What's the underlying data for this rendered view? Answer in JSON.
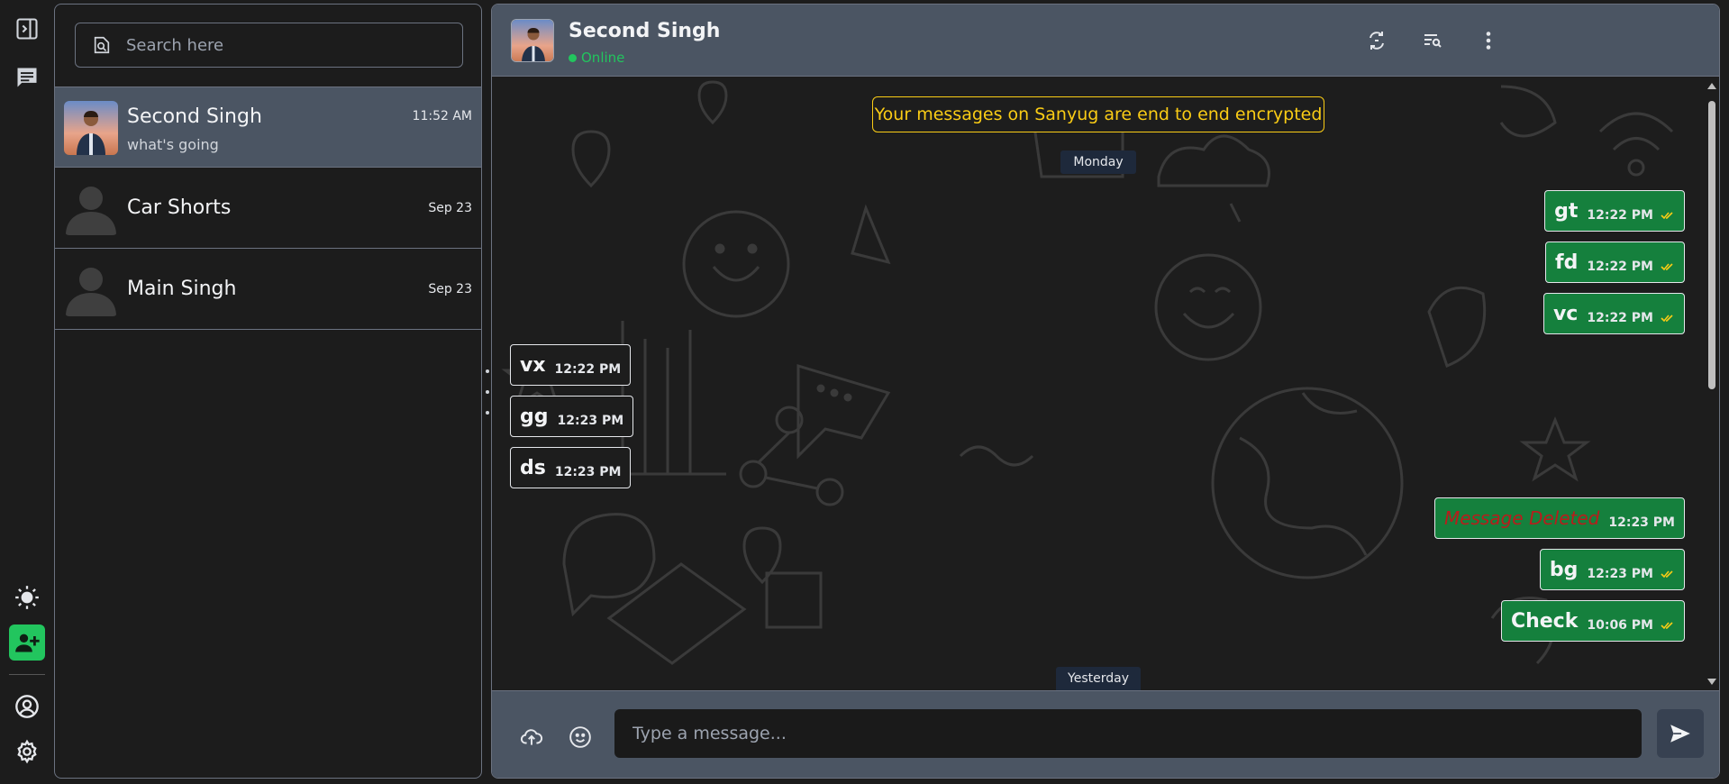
{
  "rail": {
    "top_icons": [
      "sidebar-toggle-icon",
      "chats-icon"
    ],
    "bottom_icons": [
      "theme-sun-icon",
      "add-contact-icon",
      "profile-icon",
      "settings-icon"
    ],
    "accent": "#22c55e"
  },
  "search": {
    "placeholder": "Search here"
  },
  "contacts": [
    {
      "name": "Second Singh",
      "preview": "what's going",
      "time": "11:52 AM",
      "active": true
    },
    {
      "name": "Car Shorts",
      "preview": "",
      "time": "Sep 23",
      "active": false
    },
    {
      "name": "Main Singh",
      "preview": "",
      "time": "Sep 23",
      "active": false
    }
  ],
  "header": {
    "name": "Second Singh",
    "status": "Online",
    "status_color": "#22c55e"
  },
  "chat": {
    "encryption_notice": "Your messages on Sanyug are end to end encrypted",
    "day_labels": [
      "Monday",
      "Yesterday"
    ],
    "messages": [
      {
        "text": "gt",
        "time": "12:22 PM",
        "direction": "out"
      },
      {
        "text": "fd",
        "time": "12:22 PM",
        "direction": "out"
      },
      {
        "text": "vc",
        "time": "12:22 PM",
        "direction": "out"
      },
      {
        "text": "vx",
        "time": "12:22 PM",
        "direction": "in"
      },
      {
        "text": "gg",
        "time": "12:23 PM",
        "direction": "in"
      },
      {
        "text": "ds",
        "time": "12:23 PM",
        "direction": "in"
      },
      {
        "text": "Message Deleted",
        "time": "12:23 PM",
        "direction": "out",
        "deleted": true
      },
      {
        "text": "bg",
        "time": "12:23 PM",
        "direction": "out"
      },
      {
        "text": "Check",
        "time": "10:06 PM",
        "direction": "out"
      }
    ]
  },
  "composer": {
    "placeholder": "Type a message..."
  },
  "colors": {
    "outgoing_bubble": "#15803d",
    "encryption_banner": "#facc15",
    "deleted_text": "#b91c1c"
  }
}
